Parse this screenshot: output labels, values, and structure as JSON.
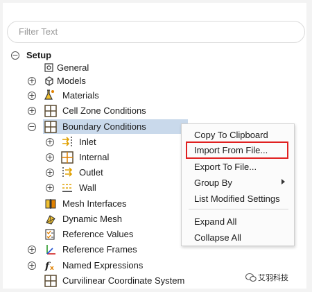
{
  "filter": {
    "placeholder": "Filter Text"
  },
  "tree": {
    "setup_label": "Setup",
    "general_label": "General",
    "models_label": "Models",
    "materials_label": "Materials",
    "cell_zone_label": "Cell Zone Conditions",
    "boundary_label": "Boundary Conditions",
    "inlet_label": "Inlet",
    "internal_label": "Internal",
    "outlet_label": "Outlet",
    "wall_label": "Wall",
    "mesh_interfaces_label": "Mesh Interfaces",
    "dynamic_mesh_label": "Dynamic Mesh",
    "reference_values_label": "Reference Values",
    "reference_frames_label": "Reference Frames",
    "named_expressions_label": "Named Expressions",
    "curvilinear_label": "Curvilinear Coordinate System",
    "expand_glyph": "+",
    "collapse_glyph": "−"
  },
  "context_menu": {
    "copy": "Copy To Clipboard",
    "import": "Import From File...",
    "export": "Export To File...",
    "group_by": "Group By",
    "list_modified": "List Modified Settings",
    "expand_all": "Expand All",
    "collapse_all": "Collapse All"
  },
  "watermark": {
    "text": "艾羽科技"
  },
  "colors": {
    "selection": "#c9d9eb",
    "highlight_border": "#e02020",
    "grid_icon": "#5a4a30",
    "arrow_icon": "#e0a000"
  }
}
